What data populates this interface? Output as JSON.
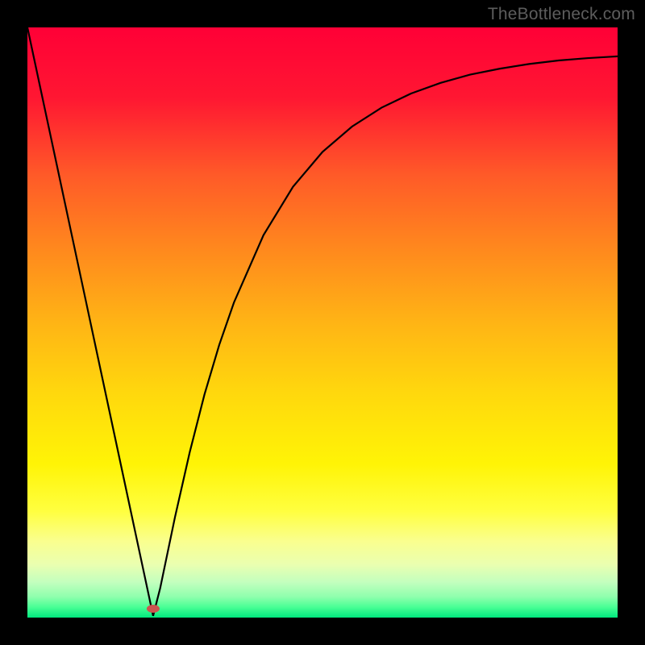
{
  "watermark": "TheBottleneck.com",
  "gradient": {
    "stops": [
      {
        "offset": 0.0,
        "color": "#ff0036"
      },
      {
        "offset": 0.12,
        "color": "#ff1732"
      },
      {
        "offset": 0.25,
        "color": "#ff5a28"
      },
      {
        "offset": 0.38,
        "color": "#ff8a1d"
      },
      {
        "offset": 0.5,
        "color": "#ffb415"
      },
      {
        "offset": 0.62,
        "color": "#ffd80d"
      },
      {
        "offset": 0.74,
        "color": "#fff406"
      },
      {
        "offset": 0.82,
        "color": "#ffff40"
      },
      {
        "offset": 0.87,
        "color": "#faff8e"
      },
      {
        "offset": 0.91,
        "color": "#eaffb0"
      },
      {
        "offset": 0.94,
        "color": "#c3ffbe"
      },
      {
        "offset": 0.965,
        "color": "#8effad"
      },
      {
        "offset": 0.982,
        "color": "#4aff95"
      },
      {
        "offset": 1.0,
        "color": "#00e87e"
      }
    ]
  },
  "marker": {
    "x_frac": 0.213,
    "y_frac": 0.985,
    "color": "#cc544f",
    "rx": 8,
    "ry": 5
  },
  "chart_data": {
    "type": "line",
    "title": "",
    "xlabel": "",
    "ylabel": "",
    "xlim": [
      0,
      1
    ],
    "ylim": [
      0,
      1
    ],
    "series": [
      {
        "name": "curve",
        "x": [
          0.0,
          0.025,
          0.05,
          0.075,
          0.1,
          0.125,
          0.15,
          0.175,
          0.2,
          0.213,
          0.225,
          0.25,
          0.275,
          0.3,
          0.325,
          0.35,
          0.4,
          0.45,
          0.5,
          0.55,
          0.6,
          0.65,
          0.7,
          0.75,
          0.8,
          0.85,
          0.9,
          0.95,
          1.0
        ],
        "y": [
          1.0,
          0.883,
          0.766,
          0.649,
          0.532,
          0.415,
          0.298,
          0.181,
          0.064,
          0.003,
          0.05,
          0.17,
          0.28,
          0.378,
          0.462,
          0.534,
          0.648,
          0.73,
          0.789,
          0.832,
          0.864,
          0.888,
          0.906,
          0.92,
          0.93,
          0.938,
          0.944,
          0.948,
          0.951
        ]
      }
    ]
  }
}
